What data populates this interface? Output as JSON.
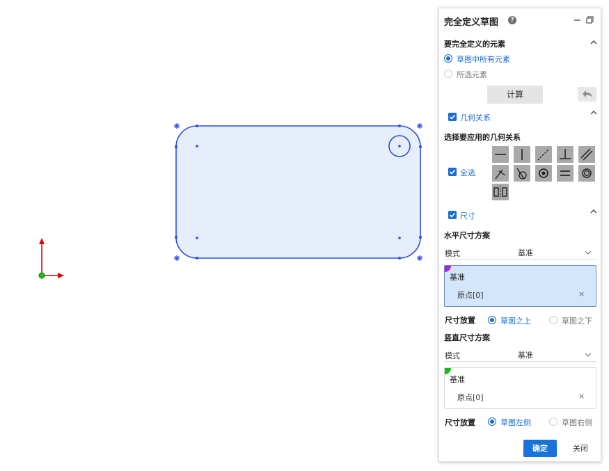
{
  "panel": {
    "title": "完全定义草图",
    "elements_section": {
      "title": "要完全定义的元素",
      "option_all": "草图中所有元素",
      "option_selected": "所选元素",
      "compute_button": "计算"
    },
    "geometry_section": {
      "checkbox_label": "几何关系",
      "subtitle": "选择要应用的几何关系",
      "select_all_label": "全选",
      "tools": [
        "horizontal-icon",
        "vertical-icon",
        "collinear-icon",
        "perpendicular-icon",
        "parallel-icon",
        "tangent-icon",
        "coradial-icon",
        "concentric-icon",
        "equal-icon",
        "coincident-icon",
        "symmetric-icon"
      ]
    },
    "dimension_section": {
      "checkbox_label": "尺寸",
      "horizontal": {
        "title": "水平尺寸方案",
        "mode_label": "模式",
        "mode_value": "基准",
        "reference_title": "基准",
        "reference_item": "原点[0]",
        "placement_label": "尺寸放置",
        "option_1": "草图之上",
        "option_2": "草图之下",
        "accent": "#b020e0"
      },
      "vertical": {
        "title": "竖直尺寸方案",
        "mode_label": "模式",
        "mode_value": "基准",
        "reference_title": "基准",
        "reference_item": "原点[0]",
        "placement_label": "尺寸放置",
        "option_1": "草图左侧",
        "option_2": "草图右侧",
        "accent": "#10c010"
      }
    },
    "footer": {
      "ok": "确定",
      "close": "关闭"
    },
    "remove_mark": "×"
  },
  "colors": {
    "primary": "#1a73d9",
    "sketch_line": "#2b4de0",
    "sketch_fill": "#e6eefc"
  }
}
